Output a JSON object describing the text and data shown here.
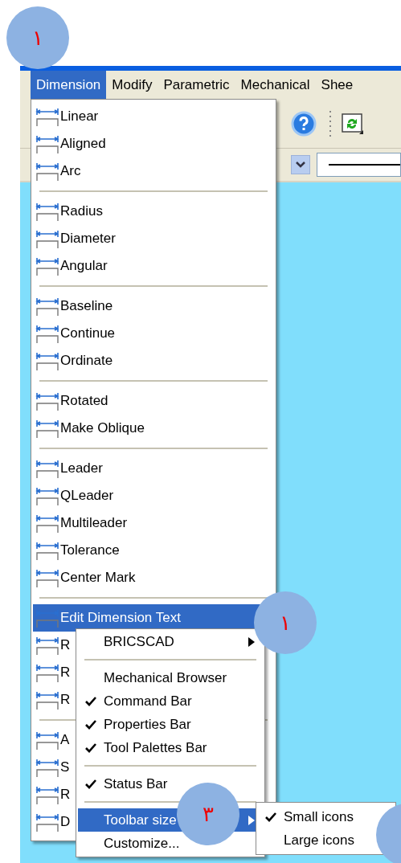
{
  "annotations": [
    {
      "label": "١"
    },
    {
      "label": "١"
    },
    {
      "label": "٣"
    }
  ],
  "menubar": [
    {
      "label": "Dimension",
      "selected": true
    },
    {
      "label": "Modify",
      "selected": false
    },
    {
      "label": "Parametric",
      "selected": false
    },
    {
      "label": "Mechanical",
      "selected": false
    },
    {
      "label": "Shee",
      "selected": false
    }
  ],
  "dimension_menu": {
    "groups": [
      [
        {
          "label": "Linear",
          "selected": false
        },
        {
          "label": "Aligned",
          "selected": false
        },
        {
          "label": "Arc",
          "selected": false
        }
      ],
      [
        {
          "label": "Radius",
          "selected": false
        },
        {
          "label": "Diameter",
          "selected": false
        },
        {
          "label": "Angular",
          "selected": false
        }
      ],
      [
        {
          "label": "Baseline",
          "selected": false
        },
        {
          "label": "Continue",
          "selected": false
        },
        {
          "label": "Ordinate",
          "selected": false
        }
      ],
      [
        {
          "label": "Rotated",
          "selected": false
        },
        {
          "label": "Make Oblique",
          "selected": false
        }
      ],
      [
        {
          "label": "Leader",
          "selected": false
        },
        {
          "label": "QLeader",
          "selected": false
        },
        {
          "label": "Multileader",
          "selected": false
        },
        {
          "label": "Tolerance",
          "selected": false
        },
        {
          "label": "Center Mark",
          "selected": false
        }
      ],
      [
        {
          "label": "Edit Dimension Text",
          "selected": true
        },
        {
          "label": "R",
          "selected": false
        },
        {
          "label": "R",
          "selected": false
        },
        {
          "label": "R",
          "selected": false
        }
      ],
      [
        {
          "label": "A",
          "selected": false
        },
        {
          "label": "S",
          "selected": false
        },
        {
          "label": "R",
          "selected": false
        },
        {
          "label": "D",
          "selected": false
        }
      ]
    ]
  },
  "context_menu": {
    "groups": [
      [
        {
          "label": "BRICSCAD",
          "checked": false,
          "submenu": true,
          "selected": false
        }
      ],
      [
        {
          "label": "Mechanical Browser",
          "checked": false,
          "submenu": false,
          "selected": false
        },
        {
          "label": "Command Bar",
          "checked": true,
          "submenu": false,
          "selected": false
        },
        {
          "label": "Properties Bar",
          "checked": true,
          "submenu": false,
          "selected": false
        },
        {
          "label": "Tool Palettes Bar",
          "checked": true,
          "submenu": false,
          "selected": false
        }
      ],
      [
        {
          "label": "Status Bar",
          "checked": true,
          "submenu": false,
          "selected": false
        }
      ],
      [
        {
          "label": "Toolbar size",
          "checked": false,
          "submenu": true,
          "selected": true
        },
        {
          "label": "Customize...",
          "checked": false,
          "submenu": false,
          "selected": false
        }
      ]
    ]
  },
  "size_menu": [
    {
      "label": "Small icons",
      "checked": true
    },
    {
      "label": "Large icons",
      "checked": false
    }
  ]
}
